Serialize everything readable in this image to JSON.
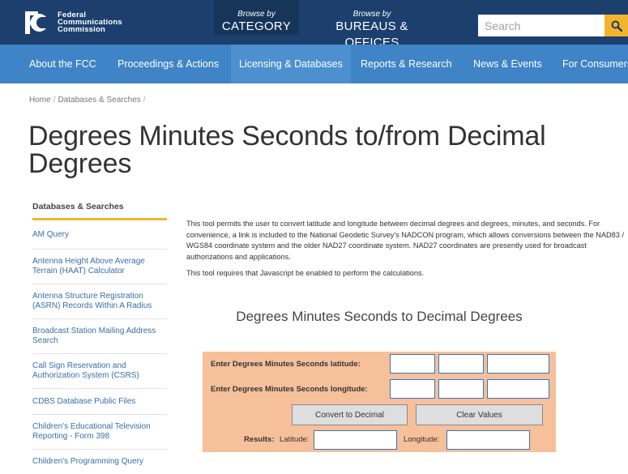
{
  "header": {
    "logo_lines": [
      "Federal",
      "Communications",
      "Commission"
    ],
    "browse_category": {
      "small": "Browse by",
      "big": "CATEGORY"
    },
    "browse_bureaus": {
      "small": "Browse by",
      "big": "BUREAUS & OFFICES"
    },
    "search_placeholder": "Search",
    "brand_color": "#1c3f6e",
    "accent_color": "#f3b42c"
  },
  "nav": {
    "items": [
      {
        "label": "About the FCC"
      },
      {
        "label": "Proceedings & Actions"
      },
      {
        "label": "Licensing & Databases"
      },
      {
        "label": "Reports & Research"
      },
      {
        "label": "News & Events"
      },
      {
        "label": "For Consumers"
      }
    ],
    "color": "#3f84c6"
  },
  "breadcrumb": {
    "items": [
      "Home",
      "Databases & Searches"
    ]
  },
  "page_title": "Degrees Minutes Seconds to/from Decimal Degrees",
  "sidebar": {
    "heading": "Databases & Searches",
    "items": [
      {
        "label": "AM Query"
      },
      {
        "label": "Antenna Height Above Average Terrain (HAAT) Calculator"
      },
      {
        "label": "Antenna Structure Registration (ASRN) Records Within A Radius"
      },
      {
        "label": "Broadcast Station Mailing Address Search"
      },
      {
        "label": "Call Sign Reservation and Authorization System (CSRS)"
      },
      {
        "label": "CDBS Database Public Files"
      },
      {
        "label": "Children's Educational Television Reporting - Form 398"
      },
      {
        "label": "Children's Programming Query"
      }
    ]
  },
  "content": {
    "para1": "This tool permits the user to convert latitude and longitude between decimal degrees and degrees, minutes, and seconds.  For convenience, a link is included to the National Geodetic Survey's NADCON program, which allows conversions between the NAD83 / WGS84 coordinate system and the older NAD27 coordinate system.  NAD27 coordinates are presently used for broadcast authorizations and applications.",
    "para2": "This tool requires that Javascript be enabled to perform the calculations."
  },
  "tool": {
    "title": "Degrees Minutes Seconds to Decimal Degrees",
    "lat_label": "Enter Degrees Minutes Seconds latitude:",
    "lon_label": "Enter Degrees Minutes Seconds longitude:",
    "convert_button": "Convert to Decimal",
    "clear_button": "Clear Values",
    "results_label": "Results:",
    "results_lat_label": "Latitude:",
    "results_lon_label": "Longitude:",
    "panel_color": "#f6c09b"
  }
}
